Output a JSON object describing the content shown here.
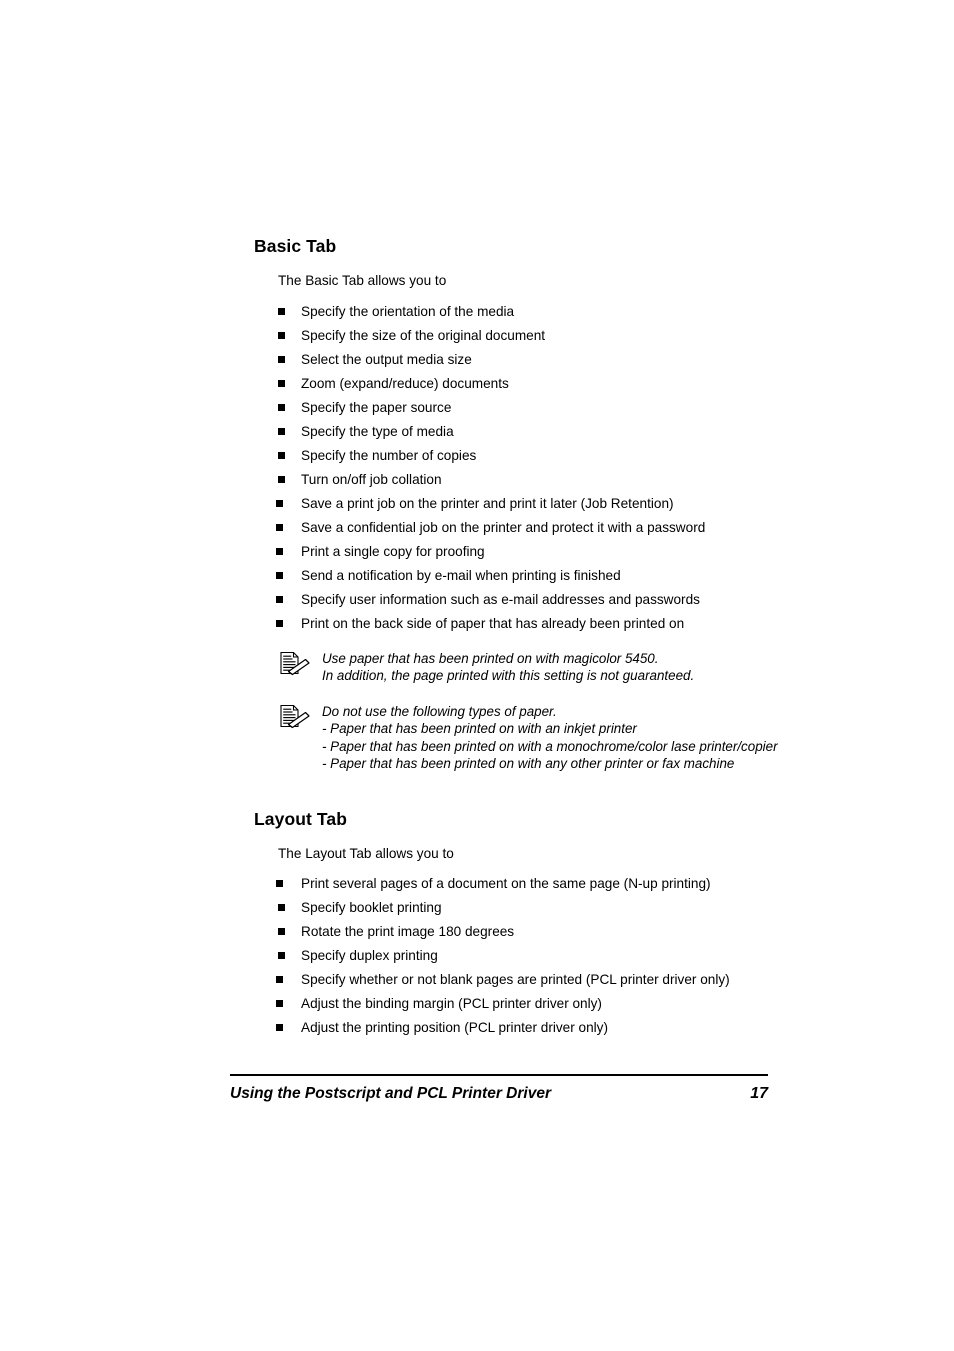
{
  "document": {
    "sections": [
      {
        "heading": "Basic Tab",
        "intro": "The Basic Tab allows you to",
        "bullets": [
          "Specify the orientation of the media",
          "Specify the size of the original document",
          "Select the output media size",
          "Zoom (expand/reduce) documents",
          "Specify the paper source",
          "Specify the type of media",
          "Specify the number of copies",
          "Turn on/off job collation",
          "Save a print job on the printer and print it later (Job Retention)",
          "Save a confidential job on the printer and protect it with a password",
          "Print a single copy for proofing",
          "Send a notification by e-mail when printing is finished",
          "Specify user information such as e-mail addresses and passwords",
          "Print on the back side of paper that has already been printed on"
        ],
        "notes": [
          {
            "icon": "note-pencil-document-icon",
            "lines": [
              "Use paper that has been printed on with magicolor 5450.",
              "In addition, the page printed with this setting is not guaranteed."
            ]
          },
          {
            "icon": "note-pencil-document-icon",
            "lines": [
              "Do not use the following types of paper.",
              "- Paper that has been printed on with an inkjet printer",
              "- Paper that has been printed on with a monochrome/color lase printer/copier",
              "- Paper that has been printed on with any other printer or fax machine"
            ]
          }
        ]
      },
      {
        "heading": "Layout Tab",
        "intro": "The Layout Tab allows you to",
        "bullets": [
          "Print several pages of a document on the same page (N-up printing)",
          "Specify booklet printing",
          "Rotate the print image 180 degrees",
          "Specify duplex printing",
          "Specify whether or not blank pages are printed (PCL printer driver only)",
          "Adjust the binding margin (PCL printer driver only)",
          "Adjust the printing position (PCL printer driver only)"
        ],
        "notes": []
      }
    ]
  },
  "footer": {
    "title": "Using the Postscript and PCL Printer Driver",
    "page_number": "17"
  },
  "colors": {
    "text": "#000000",
    "background": "#ffffff",
    "rule": "#000000"
  }
}
